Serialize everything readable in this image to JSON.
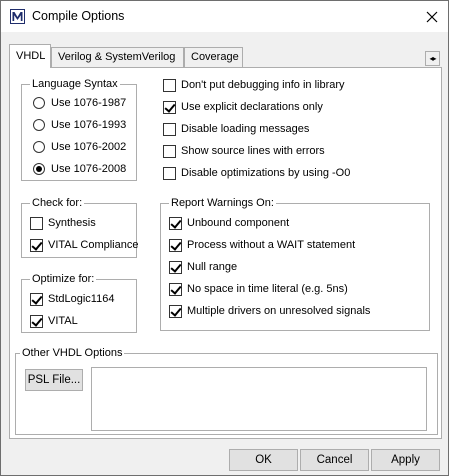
{
  "window": {
    "title": "Compile Options",
    "icon": "modelsim-m-logo",
    "close_icon": "close-icon"
  },
  "tabs": [
    {
      "label": "VHDL",
      "active": true
    },
    {
      "label": "Verilog & SystemVerilog",
      "active": false
    },
    {
      "label": "Coverage",
      "active": false
    }
  ],
  "tab_scroll_icon": "left-right-scroll-arrows",
  "language_syntax": {
    "title": "Language Syntax",
    "options": [
      {
        "label": "Use 1076-1987",
        "selected": false
      },
      {
        "label": "Use 1076-1993",
        "selected": false
      },
      {
        "label": "Use 1076-2002",
        "selected": false
      },
      {
        "label": "Use 1076-2008",
        "selected": true
      }
    ]
  },
  "general_options": [
    {
      "label": "Don't put debugging info in library",
      "checked": false
    },
    {
      "label": "Use explicit declarations only",
      "checked": true
    },
    {
      "label": "Disable loading messages",
      "checked": false
    },
    {
      "label": "Show source lines with errors",
      "checked": false
    },
    {
      "label": "Disable optimizations by using -O0",
      "checked": false
    }
  ],
  "check_for": {
    "title": "Check for:",
    "options": [
      {
        "label": "Synthesis",
        "checked": false
      },
      {
        "label": "VITAL Compliance",
        "checked": true
      }
    ]
  },
  "optimize_for": {
    "title": "Optimize for:",
    "options": [
      {
        "label": "StdLogic1164",
        "checked": true
      },
      {
        "label": "VITAL",
        "checked": true
      }
    ]
  },
  "report_warnings": {
    "title": "Report Warnings On:",
    "options": [
      {
        "label": "Unbound component",
        "checked": true
      },
      {
        "label": "Process without a WAIT statement",
        "checked": true
      },
      {
        "label": "Null range",
        "checked": true
      },
      {
        "label": "No space in time literal (e.g. 5ns)",
        "checked": true
      },
      {
        "label": "Multiple drivers on unresolved signals",
        "checked": true
      }
    ]
  },
  "other_options": {
    "title": "Other VHDL Options",
    "psl_button": "PSL File...",
    "text_value": ""
  },
  "footer": {
    "ok": "OK",
    "cancel": "Cancel",
    "apply": "Apply"
  }
}
